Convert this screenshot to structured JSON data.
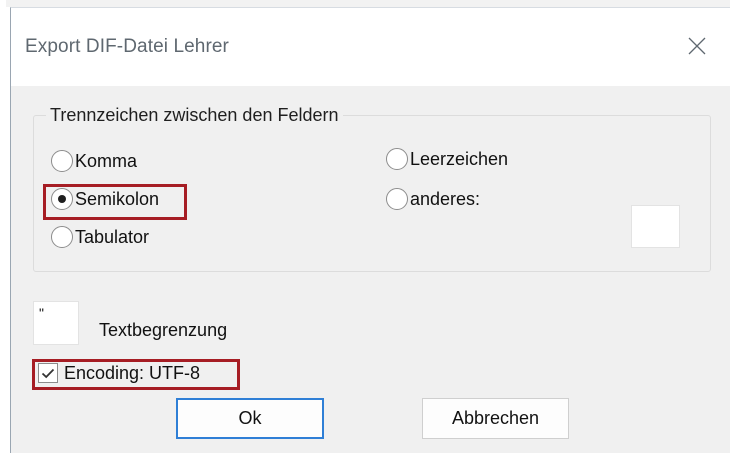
{
  "window": {
    "title": "Export DIF-Datei Lehrer",
    "close_icon": "close-icon"
  },
  "separator_group": {
    "title": "Trennzeichen zwischen den Feldern",
    "selected": "Semikolon",
    "options": [
      {
        "label": "Komma",
        "checked": false
      },
      {
        "label": "Semikolon",
        "checked": true
      },
      {
        "label": "Tabulator",
        "checked": false
      },
      {
        "label": "Leerzeichen",
        "checked": false
      },
      {
        "label": "anderes:",
        "checked": false
      }
    ],
    "custom_value": ""
  },
  "text_delimiter": {
    "value": "\"",
    "label": "Textbegrenzung"
  },
  "encoding": {
    "label": "Encoding: UTF-8",
    "checked": true,
    "check_icon": "checkmark-icon"
  },
  "buttons": {
    "ok_label": "Ok",
    "cancel_label": "Abbrechen"
  },
  "colors": {
    "highlight": "#a61d24",
    "dialog_background": "#f0f0f0",
    "default_button_border": "#2f7fd6"
  }
}
